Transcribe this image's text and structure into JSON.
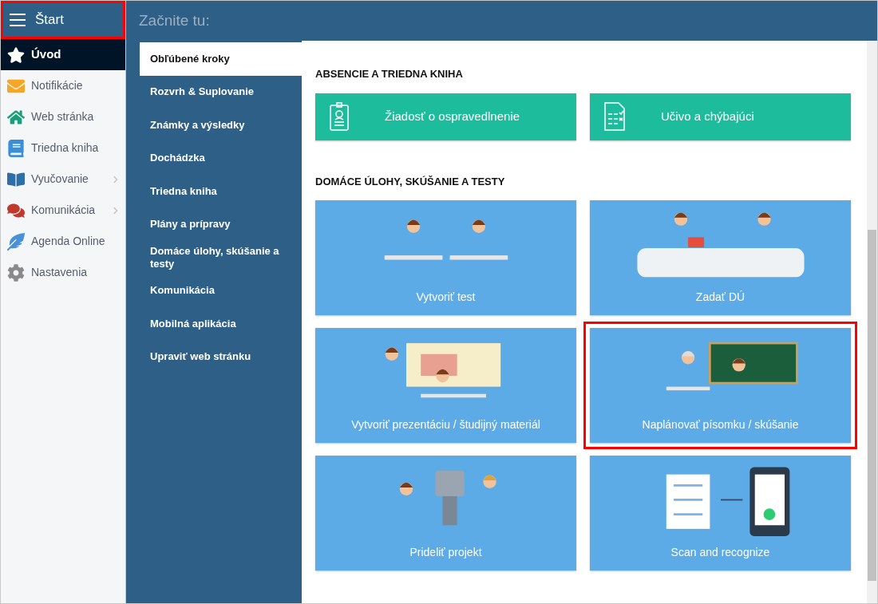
{
  "header": {
    "title": "Štart",
    "highlighted": true
  },
  "sidebar": {
    "items": [
      {
        "label": "Úvod",
        "selected": true,
        "has_submenu": false
      },
      {
        "label": "Notifikácie",
        "selected": false,
        "has_submenu": false
      },
      {
        "label": "Web stránka",
        "selected": false,
        "has_submenu": false
      },
      {
        "label": "Triedna kniha",
        "selected": false,
        "has_submenu": false
      },
      {
        "label": "Vyučovanie",
        "selected": false,
        "has_submenu": true
      },
      {
        "label": "Komunikácia",
        "selected": false,
        "has_submenu": true
      },
      {
        "label": "Agenda Online",
        "selected": false,
        "has_submenu": false
      },
      {
        "label": "Nastavenia",
        "selected": false,
        "has_submenu": false
      }
    ]
  },
  "page_title": "Začnite tu:",
  "submenu": {
    "items": [
      {
        "label": "Obľúbené kroky",
        "selected": true
      },
      {
        "label": "Rozvrh & Suplovanie",
        "selected": false
      },
      {
        "label": "Známky a výsledky",
        "selected": false
      },
      {
        "label": "Dochádzka",
        "selected": false
      },
      {
        "label": "Triedna kniha",
        "selected": false
      },
      {
        "label": "Plány a prípravy",
        "selected": false
      },
      {
        "label": "Domáce úlohy, skúšanie a testy",
        "selected": false
      },
      {
        "label": "Komunikácia",
        "selected": false
      },
      {
        "label": "Mobilná aplikácia",
        "selected": false
      },
      {
        "label": "Upraviť web stránku",
        "selected": false
      }
    ]
  },
  "sections": [
    {
      "heading": "ABSENCIE A TRIEDNA KNIHA",
      "kind": "buttons",
      "tiles": [
        {
          "label": "Žiadosť o ospravedlnenie",
          "highlighted": false
        },
        {
          "label": "Učivo a chýbajúci",
          "highlighted": false
        }
      ]
    },
    {
      "heading": "DOMÁCE ÚLOHY, SKÚŠANIE A TESTY",
      "kind": "cards",
      "tiles": [
        {
          "label": "Vytvoriť test",
          "highlighted": false
        },
        {
          "label": "Zadať DÚ",
          "highlighted": false
        },
        {
          "label": "Vytvoriť prezentáciu / študijný materiál",
          "highlighted": false
        },
        {
          "label": "Naplánovať písomku / skúšanie",
          "highlighted": true
        },
        {
          "label": "Prideliť projekt",
          "highlighted": false
        },
        {
          "label": "Scan and recognize",
          "highlighted": false
        }
      ]
    }
  ]
}
